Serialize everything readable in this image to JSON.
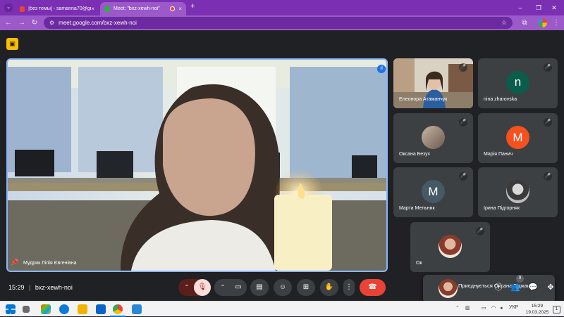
{
  "browser": {
    "tabs": [
      {
        "label": "[без темы] - samanna70@gmai",
        "close": "×"
      },
      {
        "label": "Meet: \"bxz-xewh-noi\"",
        "close": "×"
      }
    ],
    "new_tab": "+",
    "url": "meet.google.com/bxz-xewh-noi",
    "accent": "#9b59c9"
  },
  "meet": {
    "main_speaker": "Мудрик Лілія Євгенівна",
    "participants": [
      {
        "name": "Елеонора Атаманчук",
        "type": "video"
      },
      {
        "name": "nina zharovska",
        "type": "avatar",
        "initial": "n",
        "color": "#0b5d4b"
      },
      {
        "name": "Оксана Безух",
        "type": "photo"
      },
      {
        "name": "Марія Панич",
        "type": "avatar",
        "initial": "M",
        "color": "#f4511e"
      },
      {
        "name": "Марта Мельник",
        "type": "avatar",
        "initial": "M",
        "color": "#455a64"
      },
      {
        "name": "Ірина Підгорняк",
        "type": "photo"
      },
      {
        "name": "Ок",
        "type": "photo"
      }
    ],
    "notification": "Приєднується Оксана Гіджак",
    "time": "15:29",
    "meeting_code": "bxz-xewh-noi",
    "people_count": "9",
    "end_color": "#ea4335"
  },
  "taskbar": {
    "lang": "УКР",
    "time": "15:29",
    "date": "19.03.2025",
    "notif": "1"
  }
}
